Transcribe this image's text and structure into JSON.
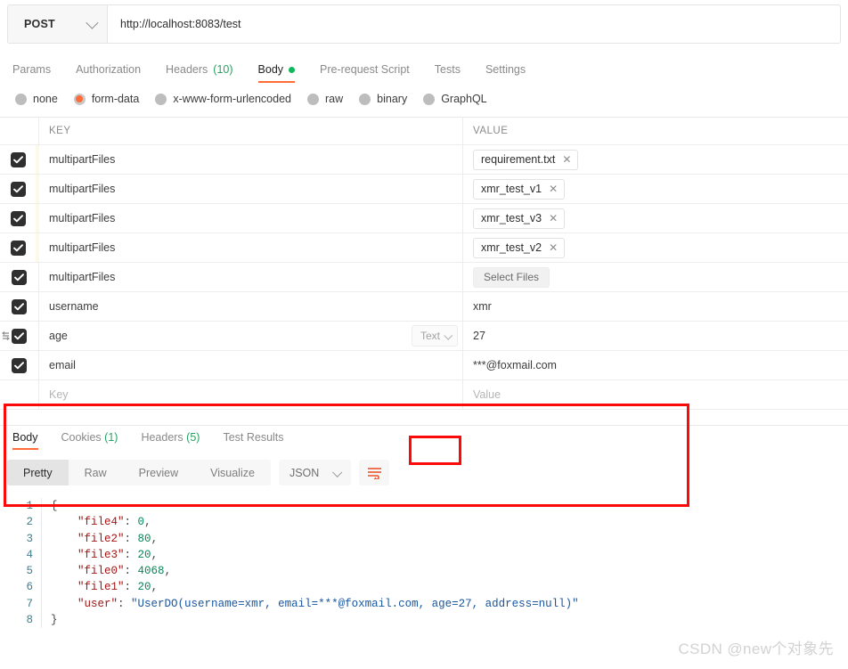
{
  "request": {
    "method": "POST",
    "url": "http://localhost:8083/test",
    "tabs": [
      {
        "label": "Params",
        "count": "",
        "active": false,
        "dot": false
      },
      {
        "label": "Authorization",
        "count": "",
        "active": false,
        "dot": false
      },
      {
        "label": "Headers",
        "count": "(10)",
        "active": false,
        "dot": false
      },
      {
        "label": "Body",
        "count": "",
        "active": true,
        "dot": true
      },
      {
        "label": "Pre-request Script",
        "count": "",
        "active": false,
        "dot": false
      },
      {
        "label": "Tests",
        "count": "",
        "active": false,
        "dot": false
      },
      {
        "label": "Settings",
        "count": "",
        "active": false,
        "dot": false
      }
    ],
    "body_types": [
      {
        "label": "none",
        "selected": false
      },
      {
        "label": "form-data",
        "selected": true
      },
      {
        "label": "x-www-form-urlencoded",
        "selected": false
      },
      {
        "label": "raw",
        "selected": false
      },
      {
        "label": "binary",
        "selected": false
      },
      {
        "label": "GraphQL",
        "selected": false
      }
    ],
    "table": {
      "col_key": "KEY",
      "col_value": "VALUE",
      "key_placeholder": "Key",
      "value_placeholder": "Value",
      "select_files_label": "Select Files",
      "type_dropdown_label": "Text",
      "rows": [
        {
          "checked": true,
          "key": "multipartFiles",
          "value": "requirement.txt",
          "kind": "file-chip",
          "tint": true
        },
        {
          "checked": true,
          "key": "multipartFiles",
          "value": "xmr_test_v1",
          "kind": "file-chip",
          "tint": true
        },
        {
          "checked": true,
          "key": "multipartFiles",
          "value": "xmr_test_v3",
          "kind": "file-chip",
          "tint": true
        },
        {
          "checked": true,
          "key": "multipartFiles",
          "value": "xmr_test_v2",
          "kind": "file-chip",
          "tint": true
        },
        {
          "checked": true,
          "key": "multipartFiles",
          "value": "Select Files",
          "kind": "select-files",
          "tint": false
        },
        {
          "checked": true,
          "key": "username",
          "value": "xmr",
          "kind": "text",
          "tint": false
        },
        {
          "checked": true,
          "key": "age",
          "value": "27",
          "kind": "text",
          "tint": false,
          "drag_handle": true,
          "type_dropdown": true
        },
        {
          "checked": true,
          "key": "email",
          "value": "***@foxmail.com",
          "kind": "text",
          "tint": false
        }
      ]
    }
  },
  "response": {
    "tabs": [
      {
        "label": "Body",
        "count": "",
        "active": true
      },
      {
        "label": "Cookies",
        "count": "(1)",
        "active": false
      },
      {
        "label": "Headers",
        "count": "(5)",
        "active": false
      },
      {
        "label": "Test Results",
        "count": "",
        "active": false
      }
    ],
    "view_modes": [
      {
        "label": "Pretty",
        "active": true
      },
      {
        "label": "Raw",
        "active": false
      },
      {
        "label": "Preview",
        "active": false
      },
      {
        "label": "Visualize",
        "active": false
      }
    ],
    "format": "JSON",
    "wrap_icon": "wrap-lines-icon",
    "code_lines": [
      {
        "no": "1",
        "segments": [
          {
            "t": "{",
            "c": "p"
          }
        ]
      },
      {
        "no": "2",
        "segments": [
          {
            "t": "    ",
            "c": "p"
          },
          {
            "t": "\"file4\"",
            "c": "k"
          },
          {
            "t": ": ",
            "c": "p"
          },
          {
            "t": "0",
            "c": "n"
          },
          {
            "t": ",",
            "c": "p"
          }
        ]
      },
      {
        "no": "3",
        "segments": [
          {
            "t": "    ",
            "c": "p"
          },
          {
            "t": "\"file2\"",
            "c": "k"
          },
          {
            "t": ": ",
            "c": "p"
          },
          {
            "t": "80",
            "c": "n"
          },
          {
            "t": ",",
            "c": "p"
          }
        ]
      },
      {
        "no": "4",
        "segments": [
          {
            "t": "    ",
            "c": "p"
          },
          {
            "t": "\"file3\"",
            "c": "k"
          },
          {
            "t": ": ",
            "c": "p"
          },
          {
            "t": "20",
            "c": "n"
          },
          {
            "t": ",",
            "c": "p"
          }
        ]
      },
      {
        "no": "5",
        "segments": [
          {
            "t": "    ",
            "c": "p"
          },
          {
            "t": "\"file0\"",
            "c": "k"
          },
          {
            "t": ": ",
            "c": "p"
          },
          {
            "t": "4068",
            "c": "n"
          },
          {
            "t": ",",
            "c": "p"
          }
        ]
      },
      {
        "no": "6",
        "segments": [
          {
            "t": "    ",
            "c": "p"
          },
          {
            "t": "\"file1\"",
            "c": "k"
          },
          {
            "t": ": ",
            "c": "p"
          },
          {
            "t": "20",
            "c": "n"
          },
          {
            "t": ",",
            "c": "p"
          }
        ]
      },
      {
        "no": "7",
        "segments": [
          {
            "t": "    ",
            "c": "p"
          },
          {
            "t": "\"user\"",
            "c": "k"
          },
          {
            "t": ": ",
            "c": "p"
          },
          {
            "t": "\"UserDO(username=xmr, email=***@foxmail.com, age=27, address=null)\"",
            "c": "s"
          }
        ]
      },
      {
        "no": "8",
        "segments": [
          {
            "t": "}",
            "c": "p"
          }
        ]
      }
    ]
  },
  "watermark": "CSDN @new个对象先",
  "colors": {
    "accent": "#ff6c37",
    "annotation": "#fb0a0a",
    "body_dot": "#0fb85a",
    "count": "#27a163"
  }
}
